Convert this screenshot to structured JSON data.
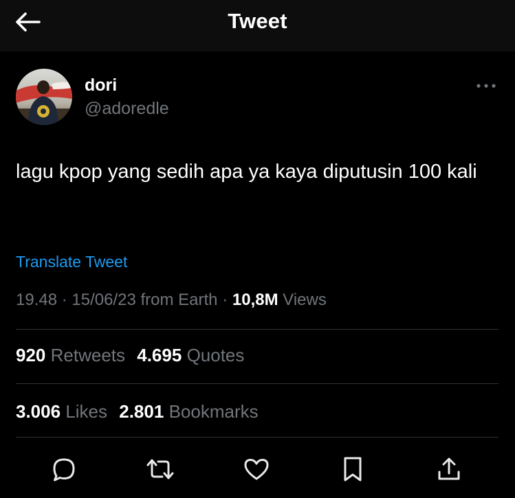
{
  "header": {
    "title": "Tweet"
  },
  "tweet": {
    "display_name": "dori",
    "handle": "@adoredle",
    "text": "lagu kpop yang sedih apa ya kaya diputusin 100 kali",
    "translate_label": "Translate Tweet",
    "time": "19.48",
    "date": "15/06/23",
    "source": "from Earth",
    "views_count": "10,8M",
    "views_label": "Views"
  },
  "stats": {
    "retweets_count": "920",
    "retweets_label": "Retweets",
    "quotes_count": "4.695",
    "quotes_label": "Quotes",
    "likes_count": "3.006",
    "likes_label": "Likes",
    "bookmarks_count": "2.801",
    "bookmarks_label": "Bookmarks"
  },
  "icons": {
    "back": "arrow-left-icon",
    "more": "more-horizontal-icon",
    "reply": "reply-bubble-icon",
    "retweet": "retweet-icon",
    "like": "heart-icon",
    "bookmark": "bookmark-icon",
    "share": "share-upload-icon"
  },
  "colors": {
    "background": "#000000",
    "header_background": "#0d0d0d",
    "text_primary": "#ffffff",
    "text_secondary": "#71767b",
    "link": "#1d9bf0",
    "divider": "#2f3336"
  }
}
